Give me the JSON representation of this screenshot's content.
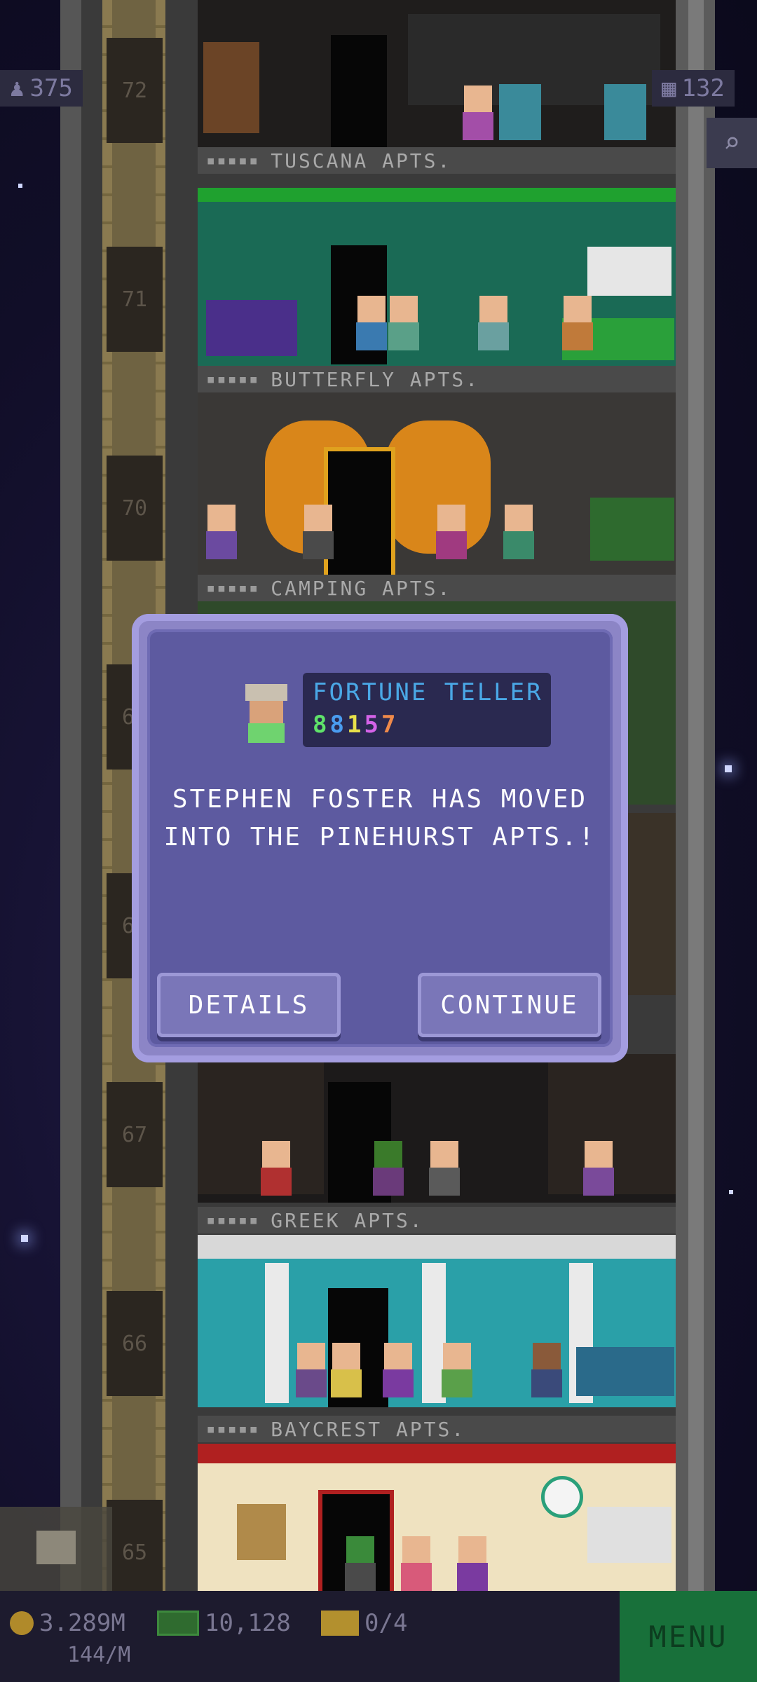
{
  "hud": {
    "population": "375",
    "floors_count": "132",
    "people_icon": "person-icon",
    "floors_icon": "building-icon",
    "search_icon": "magnifier-icon"
  },
  "tower": {
    "floor_numbers": [
      "72",
      "71",
      "70",
      "69",
      "68",
      "67",
      "66",
      "65"
    ],
    "floor_names": [
      "TUSCANA APTS.",
      "BUTTERFLY APTS.",
      "CAMPING APTS.",
      "GREEK APTS.",
      "BAYCREST APTS."
    ],
    "name_dots": "▪▪▪▪▪"
  },
  "dialog": {
    "role_title": "FORTUNE TELLER",
    "role_stats": [
      "8",
      "8",
      "1",
      "5",
      "7"
    ],
    "stat_colors": [
      "#5fe36a",
      "#4a9cf0",
      "#e8e04a",
      "#d563e8",
      "#f08a4a"
    ],
    "message": "STEPHEN FOSTER HAS MOVED INTO THE PINEHURST APTS.!",
    "details_label": "DETAILS",
    "continue_label": "CONTINUE"
  },
  "bottom": {
    "coins": "3.289M",
    "coins_rate": "144/M",
    "bux": "10,128",
    "tickets": "0/4",
    "menu_label": "MENU"
  },
  "colors": {
    "accent_green": "#18703a",
    "dialog_bg": "#5d5aa0",
    "role_title": "#4aa8e6"
  }
}
